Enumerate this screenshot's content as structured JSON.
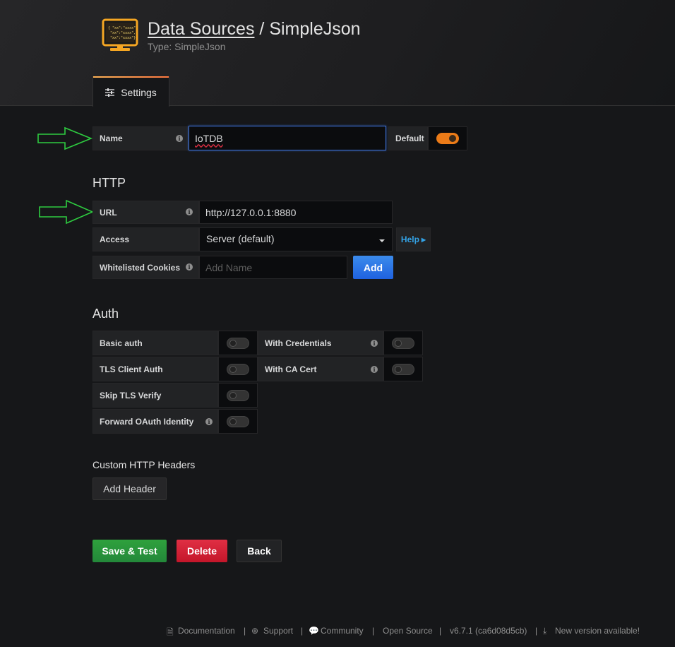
{
  "header": {
    "breadcrumb_link": "Data Sources",
    "separator": "/",
    "name": "SimpleJson",
    "subtitle": "Type: SimpleJson"
  },
  "tabs": [
    {
      "label": "Settings",
      "icon": "sliders-icon"
    }
  ],
  "basic": {
    "name_label": "Name",
    "name_value": "IoTDB",
    "default_label": "Default",
    "default_on": true
  },
  "http": {
    "title": "HTTP",
    "url_label": "URL",
    "url_value": "http://127.0.0.1:8880",
    "access_label": "Access",
    "access_value": "Server (default)",
    "help_label": "Help",
    "cookies_label": "Whitelisted Cookies",
    "cookies_placeholder": "Add Name",
    "add_label": "Add"
  },
  "auth": {
    "title": "Auth",
    "basic_auth": "Basic auth",
    "with_credentials": "With Credentials",
    "tls_client_auth": "TLS Client Auth",
    "with_ca_cert": "With CA Cert",
    "skip_tls": "Skip TLS Verify",
    "forward_oauth": "Forward OAuth Identity"
  },
  "headers": {
    "title": "Custom HTTP Headers",
    "add_header": "Add Header"
  },
  "actions": {
    "save": "Save & Test",
    "delete": "Delete",
    "back": "Back"
  },
  "footer": {
    "documentation": "Documentation",
    "support": "Support",
    "community": "Community",
    "open_source": "Open Source",
    "version": "v6.7.1 (ca6d08d5cb)",
    "new_version": "New version available!",
    "sep": "|"
  },
  "colors": {
    "accent_orange": "#eb7b18",
    "primary_blue": "#1f62e0",
    "success_green": "#23883a",
    "danger_red": "#c4162a",
    "annotation_arrow": "#2ecc40"
  }
}
